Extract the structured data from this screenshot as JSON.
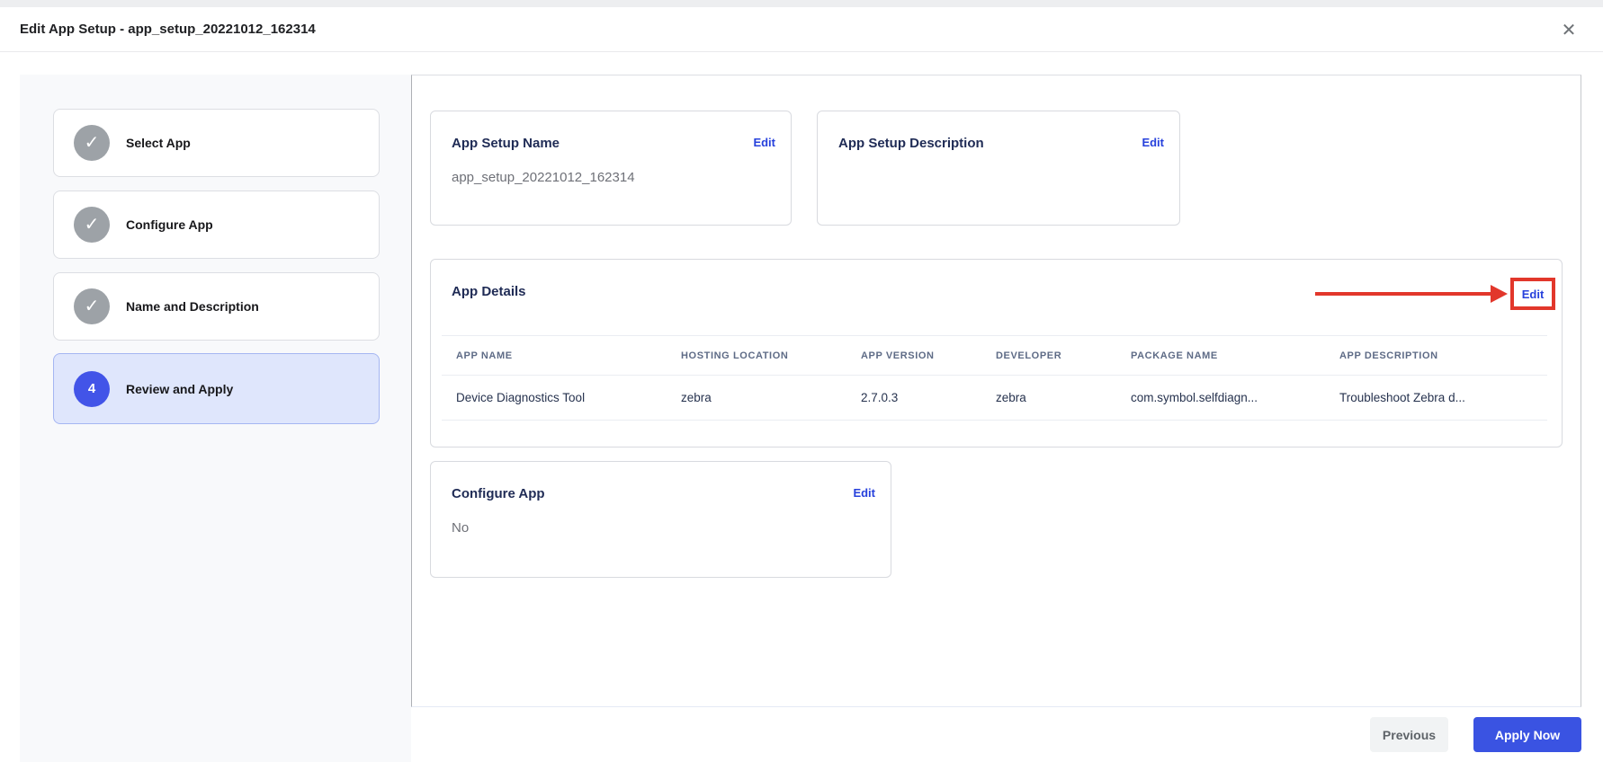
{
  "header": {
    "title": "Edit App Setup - app_setup_20221012_162314",
    "close_glyph": "✕"
  },
  "steps": [
    {
      "label": "Select App",
      "status": "done",
      "glyph": "✓"
    },
    {
      "label": "Configure App",
      "status": "done",
      "glyph": "✓"
    },
    {
      "label": "Name and Description",
      "status": "done",
      "glyph": "✓"
    },
    {
      "label": "Review and Apply",
      "status": "active",
      "glyph": "4"
    }
  ],
  "cards": {
    "app_setup_name": {
      "title": "App Setup Name",
      "edit_label": "Edit",
      "value": "app_setup_20221012_162314"
    },
    "app_setup_description": {
      "title": "App Setup Description",
      "edit_label": "Edit",
      "value": ""
    },
    "app_details": {
      "title": "App Details",
      "edit_label": "Edit",
      "table": {
        "headers": [
          "APP NAME",
          "HOSTING LOCATION",
          "APP VERSION",
          "DEVELOPER",
          "PACKAGE NAME",
          "APP DESCRIPTION"
        ],
        "rows": [
          [
            "Device Diagnostics Tool",
            "zebra",
            "2.7.0.3",
            "zebra",
            "com.symbol.selfdiagn...",
            "Troubleshoot Zebra d..."
          ]
        ]
      }
    },
    "configure_app": {
      "title": "Configure App",
      "edit_label": "Edit",
      "value": "No"
    }
  },
  "footer": {
    "previous_label": "Previous",
    "apply_label": "Apply Now"
  },
  "colors": {
    "accent_blue": "#2741DC",
    "active_step_bg": "#DFE6FC",
    "step_circle_blue": "#4254E8",
    "highlight_red": "#E2372B",
    "apply_button_blue": "#3A53E2"
  }
}
